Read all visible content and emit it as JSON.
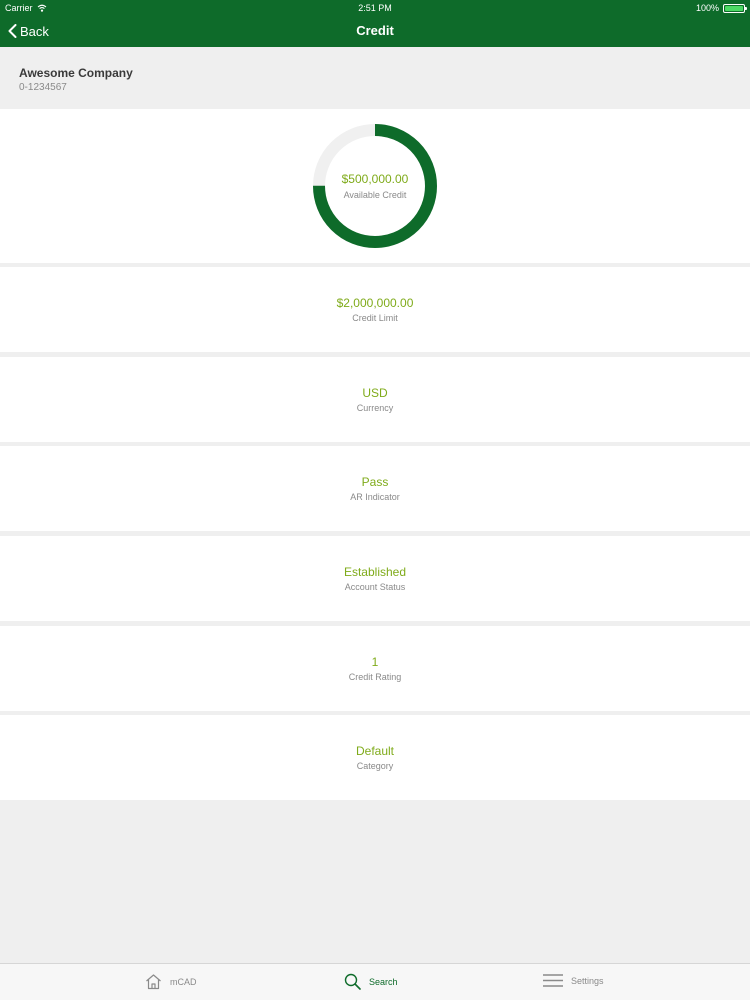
{
  "status_bar": {
    "carrier": "Carrier",
    "time": "2:51 PM",
    "battery": "100%"
  },
  "nav": {
    "back_label": "Back",
    "title": "Credit"
  },
  "company": {
    "name": "Awesome Company",
    "id": "0-1234567"
  },
  "available_credit": {
    "value": "$500,000.00",
    "label": "Available Credit",
    "fraction": 0.75,
    "color": "#0e6b2a",
    "track_color": "#f0f0f0"
  },
  "details": [
    {
      "value": "$2,000,000.00",
      "label": "Credit Limit"
    },
    {
      "value": "USD",
      "label": "Currency"
    },
    {
      "value": "Pass",
      "label": "AR Indicator"
    },
    {
      "value": "Established",
      "label": "Account Status"
    },
    {
      "value": "1",
      "label": "Credit Rating"
    },
    {
      "value": "Default",
      "label": "Category"
    }
  ],
  "tabs": [
    {
      "label": "mCAD",
      "icon": "home-icon"
    },
    {
      "label": "Search",
      "icon": "search-icon",
      "active": true
    },
    {
      "label": "Settings",
      "icon": "menu-icon"
    }
  ],
  "colors": {
    "brand": "#0e6b2a",
    "value_text": "#7fab1a",
    "label_text": "#8a8a8a"
  }
}
